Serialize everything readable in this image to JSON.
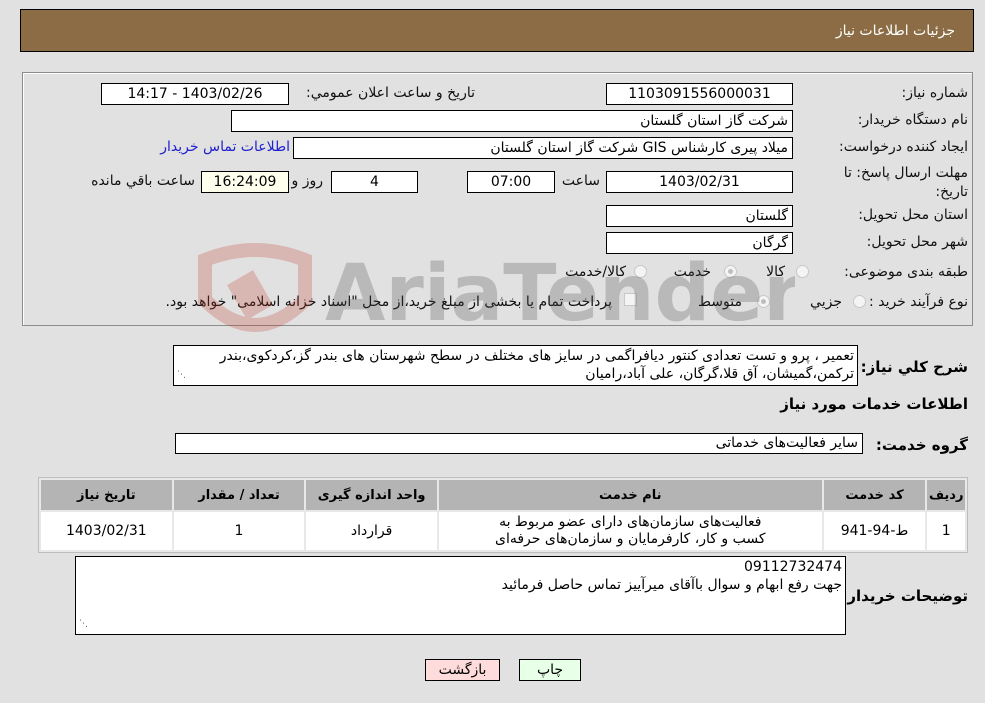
{
  "header": {
    "title": "جزئیات اطلاعات نیاز"
  },
  "form": {
    "need_number": {
      "label": "شماره نیاز:",
      "value": "1103091556000031"
    },
    "announce_datetime": {
      "label": "تاریخ و ساعت اعلان عمومي:",
      "value": "1403/02/26 - 14:17"
    },
    "buyer_org": {
      "label": "نام دستگاه خریدار:",
      "value": "شرکت گاز استان گلستان"
    },
    "creator": {
      "label": "ایجاد کننده درخواست:",
      "value": "میلاد پیری کارشناس GIS شرکت گاز استان گلستان",
      "contact_link": "اطلاعات تماس خریدار"
    },
    "deadline": {
      "label": "مهلت ارسال پاسخ: تا تاریخ:",
      "date": "1403/02/31",
      "time_label": "ساعت",
      "time": "07:00",
      "days": "4",
      "days_label": "روز و",
      "remaining": "16:24:09",
      "remaining_label": "ساعت باقي مانده"
    },
    "province": {
      "label": "استان محل تحویل:",
      "value": "گلستان"
    },
    "city": {
      "label": "شهر محل تحویل:",
      "value": "گرگان"
    },
    "category": {
      "label": "طبقه بندی موضوعی:",
      "options": [
        "کالا",
        "خدمت",
        "کالا/خدمت"
      ],
      "selected": "خدمت"
    },
    "process": {
      "label": "نوع فرآیند خرید :",
      "options": [
        "جزیي",
        "متوسط"
      ],
      "selected": "متوسط",
      "treasury_note": "پرداخت تمام یا بخشی از مبلغ خرید،از محل \"اسناد خزانه اسلامی\" خواهد بود."
    }
  },
  "description": {
    "label": "شرح کلي نیاز:",
    "value": "تعمیر ، پرو و تست تعدادی کنتور دیافراگمی در سایز های مختلف در سطح شهرستان های بندر گز،کردکوی،بندر ترکمن،گمیشان، آق قلا،گرگان، علی آباد،رامیان"
  },
  "services_section": {
    "title": "اطلاعات خدمات مورد نیاز"
  },
  "service_group": {
    "label": "گروه خدمت:",
    "value": "سایر فعالیت‌های خدماتی"
  },
  "table": {
    "headers": [
      "ردیف",
      "کد خدمت",
      "نام خدمت",
      "واحد اندازه گیری",
      "تعداد / مقدار",
      "تاریخ نیاز"
    ],
    "rows": [
      [
        "1",
        "ط-94-941",
        "فعالیت‌های سازمان‌های دارای عضو مربوط به کسب و کار، کارفرمایان و سازمان‌های حرفه‌ای",
        "قرارداد",
        "1",
        "1403/02/31"
      ]
    ]
  },
  "buyer_notes": {
    "label": "توضیحات خریدار:",
    "line1": "09112732474",
    "line2": "جهت رفع ابهام و سوال باآقای میرآییز تماس حاصل فرمائید"
  },
  "buttons": {
    "back": "بازگشت",
    "print": "چاپ"
  },
  "watermark": {
    "text": "AriaTender.neT"
  }
}
